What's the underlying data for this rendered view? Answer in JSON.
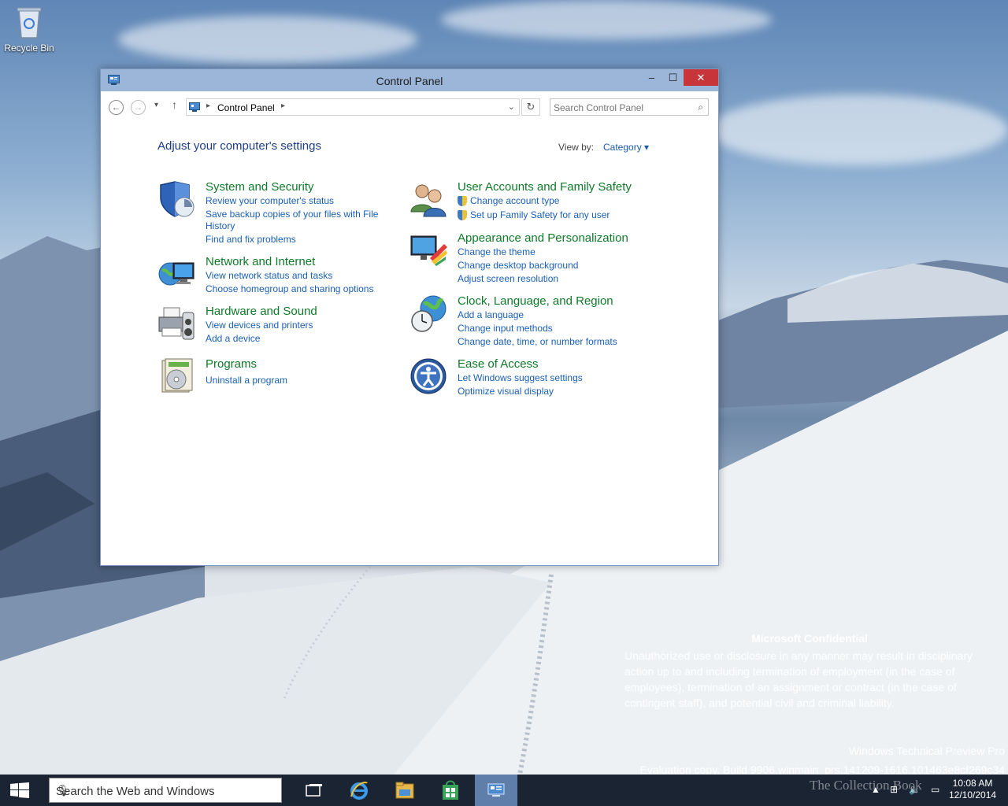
{
  "desktop": {
    "recycle_bin_label": "Recycle Bin",
    "confidential": {
      "title": "Microsoft Confidential",
      "body": "Unauthorized use or disclosure in any manner may result in disciplinary action up to and including termination of employment (in the case of employees), termination of an assignment or contract (in the case of contingent staff), and potential civil and criminal liability."
    },
    "build_line1": "Windows Technical Preview Pro",
    "build_line2": "Evaluation copy. Build 9906.winmain_prs.141209-1616.101463e8cf269c34",
    "watermark": "The Collection Book"
  },
  "window": {
    "title": "Control Panel",
    "close_glyph": "✕",
    "min_glyph": "–",
    "max_glyph": "☐",
    "address": {
      "crumb": "Control Panel"
    },
    "search": {
      "placeholder": "Search Control Panel"
    },
    "heading": "Adjust your computer's settings",
    "view_by_label": "View by:",
    "view_by_value": "Category ▾",
    "categories": [
      {
        "title": "System and Security",
        "links": [
          "Review your computer's status",
          "Save backup copies of your files with File",
          "History",
          "Find and fix problems"
        ]
      },
      {
        "title": "Network and Internet",
        "links": [
          "View network status and tasks",
          "Choose homegroup and sharing options"
        ]
      },
      {
        "title": "Hardware and Sound",
        "links": [
          "View devices and printers",
          "Add a device"
        ]
      },
      {
        "title": "Programs",
        "links": [
          "Uninstall a program"
        ]
      },
      {
        "title": "User Accounts and Family Safety",
        "links": [
          "Change account type",
          "Set up Family Safety for any user"
        ]
      },
      {
        "title": "Appearance and Personalization",
        "links": [
          "Change the theme",
          "Change desktop background",
          "Adjust screen resolution"
        ]
      },
      {
        "title": "Clock, Language, and Region",
        "links": [
          "Add a language",
          "Change input methods",
          "Change date, time, or number formats"
        ]
      },
      {
        "title": "Ease of Access",
        "links": [
          "Let Windows suggest settings",
          "Optimize visual display"
        ]
      }
    ]
  },
  "taskbar": {
    "search_placeholder": "Search the Web and Windows",
    "time": "10:08 AM",
    "date": "12/10/2014"
  },
  "icons": [
    "recycle-bin-icon",
    "control-panel-icon",
    "back-icon",
    "forward-icon",
    "recent-dropdown-icon",
    "up-icon",
    "refresh-icon",
    "search-icon",
    "shield-icon",
    "network-icon",
    "printer-icon",
    "programs-icon",
    "users-icon",
    "monitor-icon",
    "globe-clock-icon",
    "ease-of-access-icon",
    "start-icon",
    "microphone-icon",
    "task-view-icon",
    "internet-explorer-icon",
    "file-explorer-icon",
    "store-icon"
  ]
}
